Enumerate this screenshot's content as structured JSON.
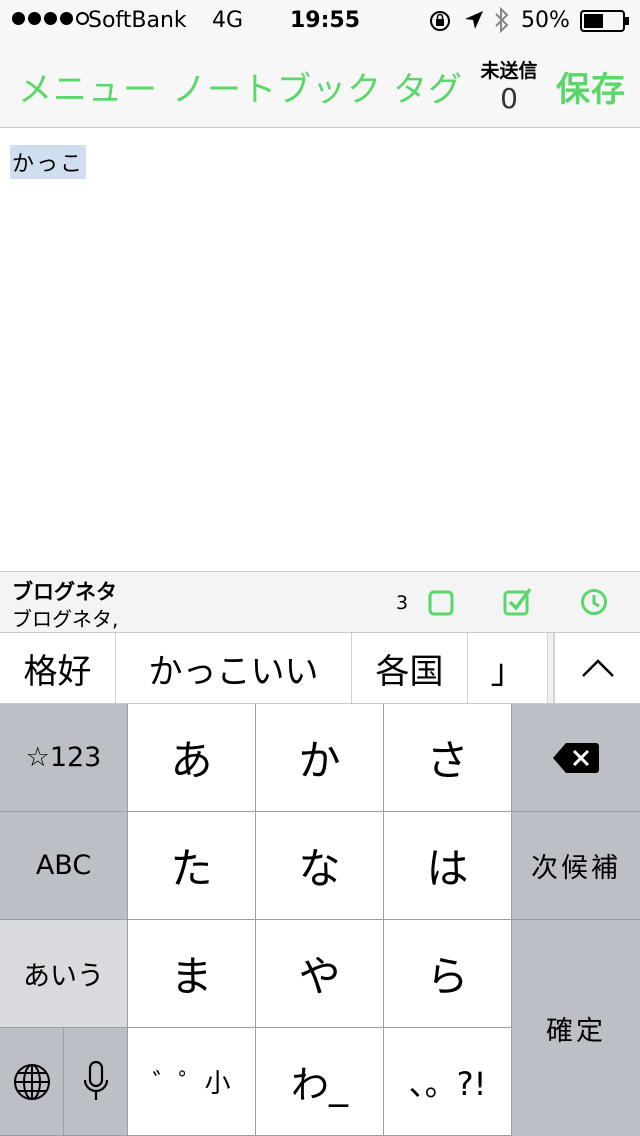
{
  "status_bar": {
    "carrier": "SoftBank",
    "network": "4G",
    "time": "19:55",
    "battery_percent": "50%",
    "battery_level": 0.5,
    "signal_bars_filled": 4,
    "signal_bars_total": 5
  },
  "nav": {
    "menu": "メニュー",
    "notebook": "ノートブック",
    "tag": "タグ",
    "unsent_label": "未送信",
    "unsent_count": "0",
    "save": "保存",
    "accent_color": "#5bd669"
  },
  "editor": {
    "text": "かっこ"
  },
  "info_strip": {
    "notebook_name": "ブログネタ",
    "notebook_sub": "ブログネタ,",
    "count": "3"
  },
  "candidates": [
    "格好",
    "かっこいい",
    "各国",
    "」"
  ],
  "keyboard": {
    "left": [
      "☆123",
      "ABC",
      "あいう"
    ],
    "center": [
      [
        "あ",
        "か",
        "さ"
      ],
      [
        "た",
        "な",
        "は"
      ],
      [
        "ま",
        "や",
        "ら"
      ],
      [
        "゛゜小",
        "わ_",
        "、。?!"
      ]
    ],
    "right": {
      "next": "次候補",
      "confirm": "確定"
    }
  }
}
